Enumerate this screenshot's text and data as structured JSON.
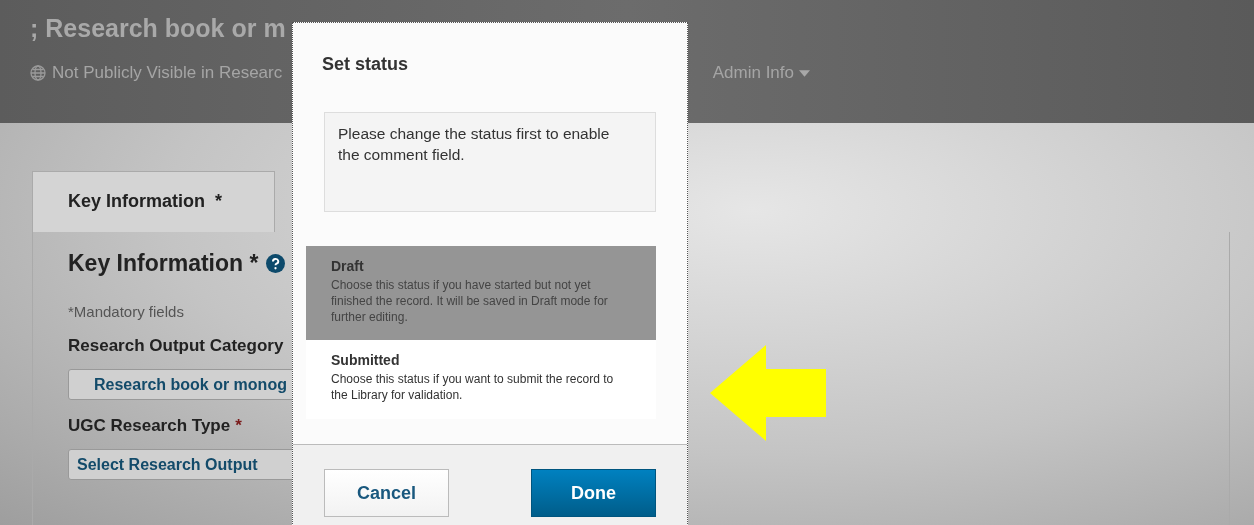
{
  "page": {
    "title": "; Research book or m",
    "visibility": "Not Publicly Visible in Researc",
    "admin_menu": "Admin Info",
    "tabs": [
      {
        "label": "Key Information  *",
        "selected": true
      }
    ],
    "section": {
      "heading": "Key Information *",
      "note": "*Mandatory fields",
      "fields": [
        {
          "label": "Research Output Category",
          "value": "Research book or monog"
        },
        {
          "label": "UGC Research Type",
          "required_mark": "*",
          "value": "Select Research Output"
        }
      ]
    }
  },
  "dialog": {
    "title": "Set status",
    "comment": {
      "placeholder": "Please change the status first to enable the comment field.",
      "disabled": true
    },
    "statuses": [
      {
        "name": "Draft",
        "description": "Choose this status if you have started but not yet finished the record. It will be saved in Draft mode for further editing.",
        "selected": true
      },
      {
        "name": "Submitted",
        "description": "Choose this status if you want to submit the record to the Library for validation.",
        "selected": false
      }
    ],
    "buttons": [
      {
        "label": "Cancel",
        "kind": "secondary"
      },
      {
        "label": "Done",
        "kind": "primary"
      }
    ]
  }
}
